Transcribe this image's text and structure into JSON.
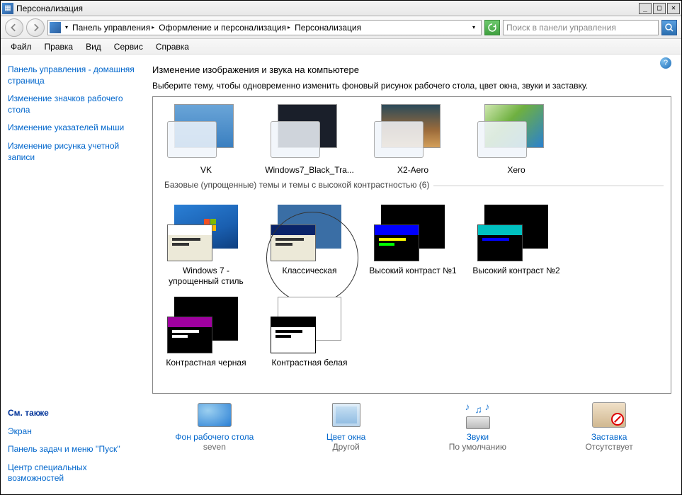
{
  "window": {
    "title": "Персонализация"
  },
  "breadcrumb": {
    "items": [
      "Панель управления",
      "Оформление и персонализация",
      "Персонализация"
    ]
  },
  "search": {
    "placeholder": "Поиск в панели управления"
  },
  "menu": {
    "file": "Файл",
    "edit": "Правка",
    "view": "Вид",
    "tools": "Сервис",
    "help": "Справка"
  },
  "sidebar": {
    "home": "Панель управления - домашняя страница",
    "icons": "Изменение значков рабочего стола",
    "pointers": "Изменение указателей мыши",
    "account_pic": "Изменение рисунка учетной записи",
    "see_also": "См. также",
    "display": "Экран",
    "taskbar": "Панель задач и меню ''Пуск''",
    "ease": "Центр специальных возможностей"
  },
  "page": {
    "title": "Изменение изображения и звука на компьютере",
    "subtitle": "Выберите тему, чтобы одновременно изменить фоновый рисунок рабочего стола, цвет окна, звуки и заставку.",
    "section_basic": "Базовые (упрощенные) темы и темы с высокой контрастностью (6)"
  },
  "themes": {
    "aero": [
      "VK",
      "Windows7_Black_Tra...",
      "X2-Aero",
      "Xero"
    ],
    "basic": [
      "Windows 7 - упрощенный стиль",
      "Классическая",
      "Высокий контраст №1",
      "Высокий контраст №2",
      "Контрастная черная",
      "Контрастная белая"
    ]
  },
  "bottom": {
    "bg_label": "Фон рабочего стола",
    "bg_value": "seven",
    "color_label": "Цвет окна",
    "color_value": "Другой",
    "sound_label": "Звуки",
    "sound_value": "По умолчанию",
    "saver_label": "Заставка",
    "saver_value": "Отсутствует"
  }
}
